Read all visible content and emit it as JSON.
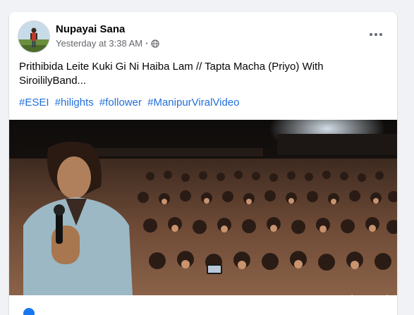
{
  "post": {
    "author": "Nupayai Sana",
    "timestamp": "Yesterday at 3:38 AM",
    "separator": "·",
    "privacy_icon": "globe-icon",
    "more_icon": "more-options-icon",
    "text": "Prithibida Leite Kuki Gi Ni Haiba Lam // Tapta Macha (Priyo) With SiroililyBand...",
    "hashtags": [
      "#ESEI",
      "#hilights",
      "#follower",
      "#ManipurViralVideo"
    ]
  },
  "overlay": {
    "watermark": "Activate Win"
  },
  "colors": {
    "page_background": "#f0f2f5",
    "card_background": "#ffffff",
    "link": "#216fdb",
    "secondary_text": "#65676b"
  }
}
